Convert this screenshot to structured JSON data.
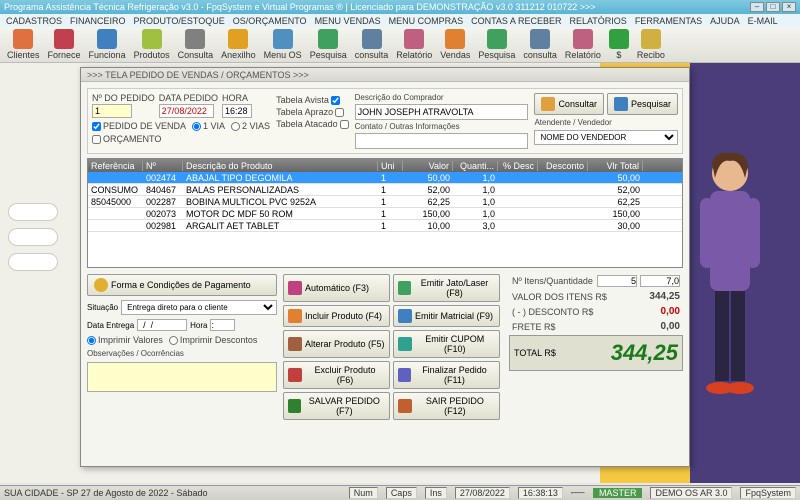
{
  "title": "Programa Assistência Técnica Refrigeração v3.0 - FpqSystem e Virtual Programas ® | Licenciado para  DEMONSTRAÇÃO v3.0 311212 010722 >>>",
  "menu": [
    "CADASTROS",
    "FINANCEIRO",
    "PRODUTO/ESTOQUE",
    "OS/ORÇAMENTO",
    "MENU VENDAS",
    "MENU COMPRAS",
    "CONTAS A RECEBER",
    "RELATÓRIOS",
    "FERRAMENTAS",
    "AJUDA",
    "E-MAIL"
  ],
  "toolbar": [
    {
      "label": "Clientes",
      "color": "#e07040"
    },
    {
      "label": "Fornece",
      "color": "#c04050"
    },
    {
      "label": "Funciona",
      "color": "#4080c0"
    },
    {
      "label": "Produtos",
      "color": "#a0c040"
    },
    {
      "label": "Consulta",
      "color": "#808080"
    },
    {
      "label": "Anexilho",
      "color": "#e0a020"
    },
    {
      "label": "Menu OS",
      "color": "#5090c0"
    },
    {
      "label": "Pesquisa",
      "color": "#40a060"
    },
    {
      "label": "consulta",
      "color": "#6080a0"
    },
    {
      "label": "Relatório",
      "color": "#c06080"
    },
    {
      "label": "Vendas",
      "color": "#e08030"
    },
    {
      "label": "Pesquisa",
      "color": "#40a060"
    },
    {
      "label": "consulta",
      "color": "#6080a0"
    },
    {
      "label": "Relatório",
      "color": "#c06080"
    },
    {
      "label": "$",
      "color": "#30a040"
    },
    {
      "label": "Recibo",
      "color": "#d0b040"
    }
  ],
  "modal": {
    "title": ">>>  TELA PEDIDO DE VENDAS / ORÇAMENTOS  >>>",
    "num_pedido_lbl": "Nº DO PEDIDO",
    "num_pedido": "1",
    "data_pedido_lbl": "DATA PEDIDO",
    "data_pedido": "27/08/2022",
    "hora_lbl": "HORA",
    "hora": "16:28",
    "pedido_venda_lbl": "PEDIDO DE VENDA",
    "orcamento_lbl": "ORÇAMENTO",
    "via1": "1 VIA",
    "via2": "2 VIAS",
    "tab_avista": "Tabela Avista",
    "tab_aprazo": "Tabela Aprazo",
    "tab_atacado": "Tabela Atacado",
    "desc_comp_lbl": "Descrição do Comprador",
    "desc_comp": "JOHN JOSEPH ATRAVOLTA",
    "contato_lbl": "Contato / Outras Informações",
    "atend_lbl": "Atendente / Vendedor",
    "atend": "NOME DO VENDEDOR",
    "btn_consultar": "Consultar",
    "btn_pesquisar": "Pesquisar",
    "grid_head": [
      "Referência",
      "Nº",
      "Descrição do Produto",
      "Uni",
      "Valor",
      "Quanti...",
      "% Desc",
      "Desconto",
      "Vlr Total"
    ],
    "rows": [
      {
        "ref": "",
        "no": "002474",
        "desc": "ABAJAL TIPO DEGOMILA",
        "uni": "1",
        "val": "50,00",
        "qt": "1,0",
        "pd": "",
        "dc": "",
        "tot": "50,00",
        "sel": true
      },
      {
        "ref": "CONSUMO",
        "no": "840467",
        "desc": "BALAS PERSONALIZADAS",
        "uni": "1",
        "val": "52,00",
        "qt": "1,0",
        "pd": "",
        "dc": "",
        "tot": "52,00"
      },
      {
        "ref": "85045000",
        "no": "002287",
        "desc": "BOBINA MULTICOL PVC 9252A",
        "uni": "1",
        "val": "62,25",
        "qt": "1,0",
        "pd": "",
        "dc": "",
        "tot": "62,25"
      },
      {
        "ref": "",
        "no": "002073",
        "desc": "MOTOR DC MDF 50 ROM",
        "uni": "1",
        "val": "150,00",
        "qt": "1,0",
        "pd": "",
        "dc": "",
        "tot": "150,00"
      },
      {
        "ref": "",
        "no": "002981",
        "desc": "ARGALIT AET TABLET",
        "uni": "1",
        "val": "10,00",
        "qt": "3,0",
        "pd": "",
        "dc": "",
        "tot": "30,00"
      }
    ],
    "forma_pag": "Forma e Condições de Pagamento",
    "situacao_lbl": "Situação",
    "situacao": "Entrega direto para o cliente",
    "data_entrega_lbl": "Data Entrega",
    "data_entrega": "  /  /",
    "hora2_lbl": "Hora",
    "hora2": ":",
    "imp_val": "Imprimir Valores",
    "imp_desc": "Imprimir Descontos",
    "obs_lbl": "Observações / Ocorrências",
    "btns": [
      {
        "t": "Automático",
        "k": "(F3)"
      },
      {
        "t": "Emitir Jato/Laser",
        "k": "(F8)"
      },
      {
        "t": "Incluir Produto",
        "k": "(F4)"
      },
      {
        "t": "Emitir Matricial",
        "k": "(F9)"
      },
      {
        "t": "Alterar Produto",
        "k": "(F5)"
      },
      {
        "t": "Emitir CUPOM",
        "k": "(F10)"
      },
      {
        "t": "Excluir Produto",
        "k": "(F6)"
      },
      {
        "t": "Finalizar Pedido",
        "k": "(F11)"
      },
      {
        "t": "SALVAR PEDIDO",
        "k": "(F7)"
      },
      {
        "t": "SAIR  PEDIDO",
        "k": "(F12)"
      }
    ],
    "tot": {
      "itens_lbl": "Nº Itens/Quantidade",
      "itens": "5",
      "qtd": "7,0",
      "valor_lbl": "VALOR DOS ITENS R$",
      "valor": "344,25",
      "desc_lbl": "( - ) DESCONTO R$",
      "desc": "0,00",
      "frete_lbl": "FRETE R$",
      "frete": "0,00",
      "total_lbl": "TOTAL R$",
      "total": "344,25"
    }
  },
  "status": {
    "city": "SUA CIDADE - SP 27 de Agosto de 2022 - Sábado",
    "num": "Num",
    "caps": "Caps",
    "ins": "Ins",
    "date": "27/08/2022",
    "time": "16:38:13",
    "master": "MASTER",
    "demo": "DEMO OS AR 3.0",
    "fpq": "FpqSystem"
  }
}
